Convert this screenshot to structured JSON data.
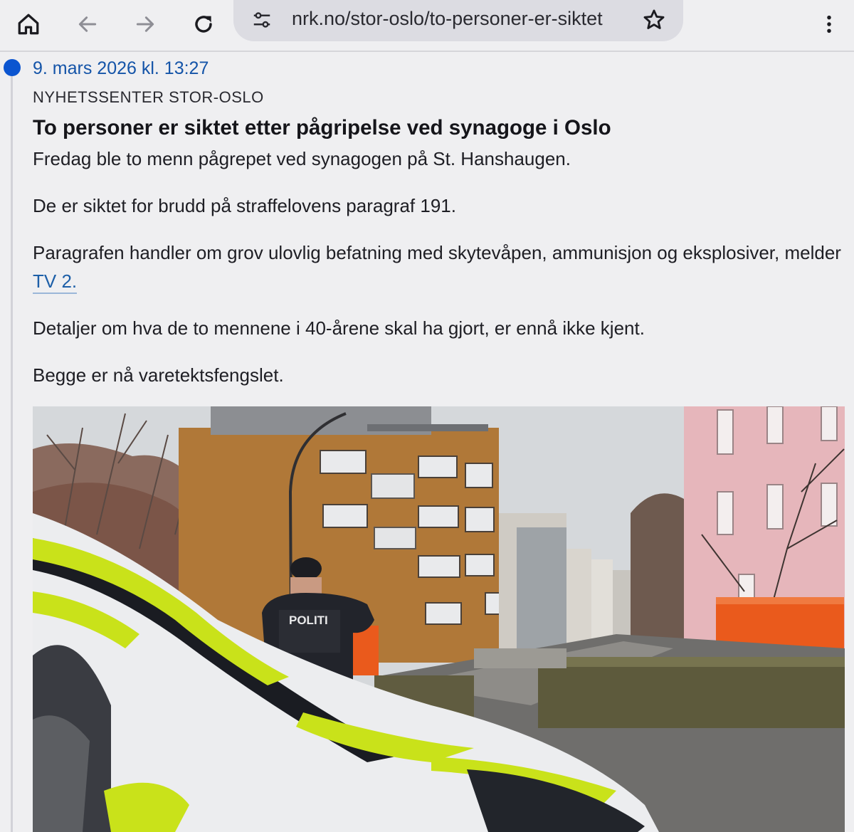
{
  "browser": {
    "url": "nrk.no/stor-oslo/to-personer-er-siktet",
    "icons": {
      "home": "home-icon",
      "back": "arrow-left-icon",
      "forward": "arrow-right-icon",
      "reload": "reload-icon",
      "site_info": "tune-icon",
      "bookmark": "star-icon",
      "menu": "more-vert-icon"
    }
  },
  "article": {
    "timestamp": "9. mars 2026 kl. 13:27",
    "section": "NYHETSSENTER STOR-OSLO",
    "headline": "To personer er siktet etter pågripelse ved synagoge i Oslo",
    "paragraphs": {
      "p1": "Fredag ble to menn pågrepet ved synagogen på St. Hanshaugen.",
      "p2": "De er siktet for brudd på straffelovens paragraf 191.",
      "p3_before": "Paragrafen handler om grov ulovlig befatning med skytevåpen, ammunisjon og eksplosiver, melder ",
      "p3_link": "TV 2.",
      "p4": "Detaljer om hva de to mennene i 40-årene skal ha gjort, er ennå ikke kjent.",
      "p5": "Begge er nå varetektsfengslet."
    },
    "photo": {
      "vest_text": "POLITI"
    }
  },
  "colors": {
    "accent_blue": "#0b55d0",
    "link": "#1d5fa8",
    "timestamp": "#1454a8",
    "background": "#efeff1"
  }
}
